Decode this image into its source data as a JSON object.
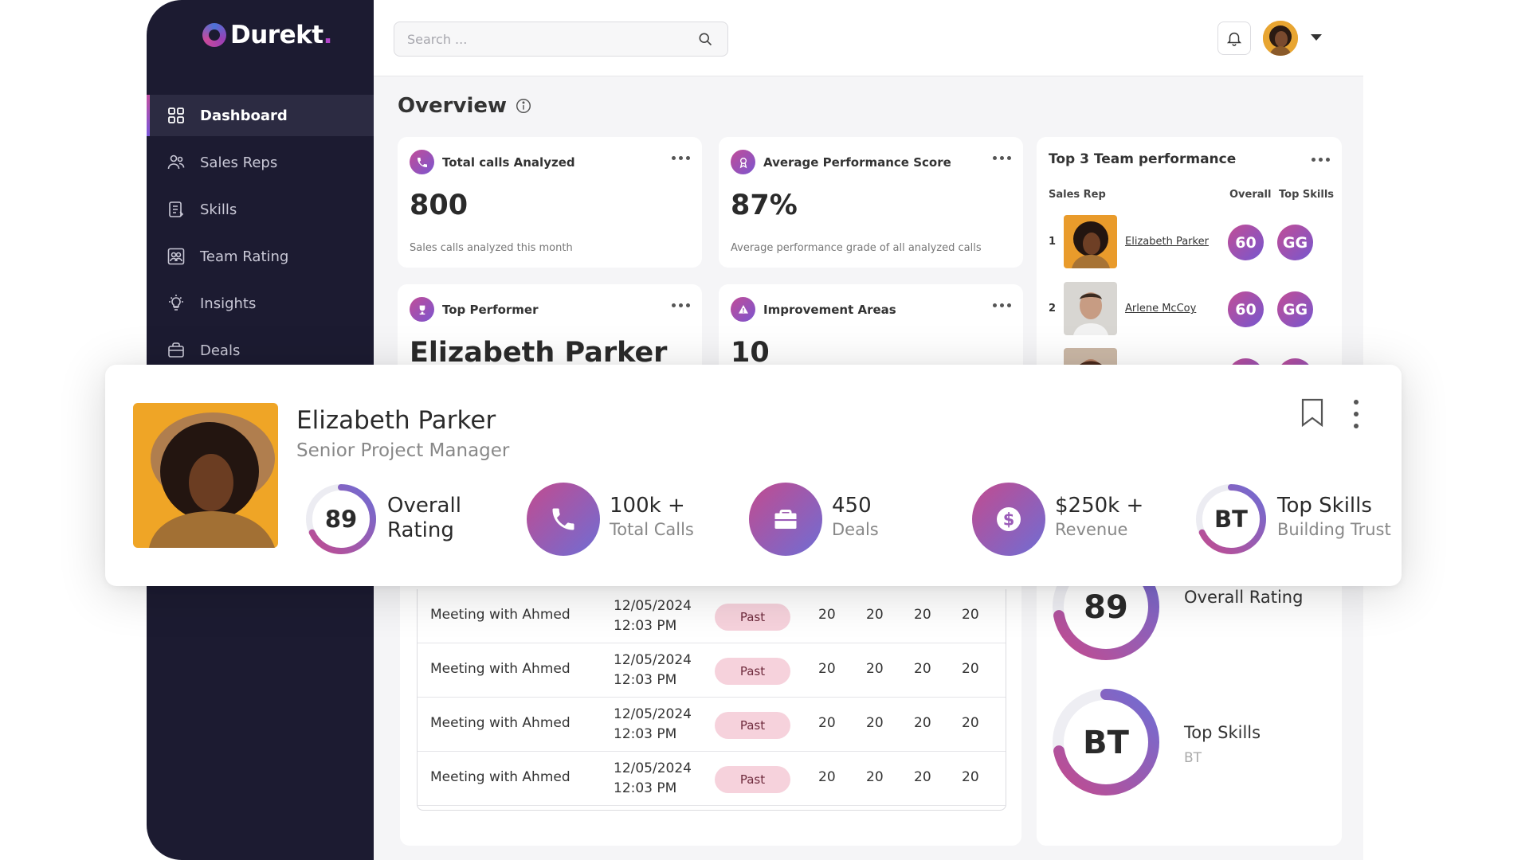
{
  "app": {
    "logo_text": "Durekt",
    "logo_dot": "."
  },
  "sidebar": {
    "items": [
      {
        "label": "Dashboard",
        "icon": "dashboard-icon",
        "active": true
      },
      {
        "label": "Sales Reps",
        "icon": "users-icon"
      },
      {
        "label": "Skills",
        "icon": "skills-icon"
      },
      {
        "label": "Team Rating",
        "icon": "team-rating-icon"
      },
      {
        "label": "Insights",
        "icon": "lightbulb-icon"
      },
      {
        "label": "Deals",
        "icon": "briefcase-icon"
      }
    ]
  },
  "header": {
    "search_placeholder": "Search ..."
  },
  "overview": {
    "title": "Overview",
    "cards": [
      {
        "title": "Total calls Analyzed",
        "value": "800",
        "sub": "Sales calls analyzed this month",
        "icon": "phone-icon"
      },
      {
        "title": "Average Performance Score",
        "value": "87%",
        "sub": "Average performance grade of all analyzed calls",
        "icon": "award-icon"
      },
      {
        "title": "Top Performer",
        "value": "Elizabeth Parker",
        "icon": "trophy-icon"
      },
      {
        "title": "Improvement Areas",
        "value": "10",
        "icon": "alert-icon"
      }
    ]
  },
  "team": {
    "title": "Top 3 Team performance",
    "col_rep": "Sales Rep",
    "col_overall": "Overall",
    "col_skills": "Top Skills",
    "rows": [
      {
        "rank": "1",
        "name": "Elizabeth Parker",
        "overall": "60",
        "skills": "GG"
      },
      {
        "rank": "2",
        "name": "Arlene McCoy",
        "overall": "60",
        "skills": "GG"
      }
    ]
  },
  "meetings": {
    "rows": [
      {
        "name": "Meeting with Ahmed",
        "date": "12/05/2024",
        "time": "12:03 PM",
        "status": "Past",
        "a": "20",
        "b": "20",
        "c": "20",
        "d": "20"
      },
      {
        "name": "Meeting with Ahmed",
        "date": "12/05/2024",
        "time": "12:03 PM",
        "status": "Past",
        "a": "20",
        "b": "20",
        "c": "20",
        "d": "20"
      },
      {
        "name": "Meeting with Ahmed",
        "date": "12/05/2024",
        "time": "12:03 PM",
        "status": "Past",
        "a": "20",
        "b": "20",
        "c": "20",
        "d": "20"
      },
      {
        "name": "Meeting with Ahmed",
        "date": "12/05/2024",
        "time": "12:03 PM",
        "status": "Past",
        "a": "20",
        "b": "20",
        "c": "20",
        "d": "20"
      }
    ]
  },
  "rep_summary": {
    "overall_value": "89",
    "overall_label": "Overall Rating",
    "overall_fraction": 0.72,
    "skills_value": "BT",
    "skills_label": "Top Skills",
    "skills_sub": "BT",
    "skills_fraction": 0.72
  },
  "profile": {
    "name": "Elizabeth Parker",
    "role": "Senior Project Manager",
    "rating_value": "89",
    "rating_fraction": 0.68,
    "rating_line1": "Overall",
    "rating_line2": "Rating",
    "calls_line1": "100k +",
    "calls_line2": "Total Calls",
    "deals_line1": "450",
    "deals_line2": "Deals",
    "revenue_line1": "$250k +",
    "revenue_line2": "Revenue",
    "skills_badge": "BT",
    "skills_fraction": 0.68,
    "skills_line1": "Top Skills",
    "skills_line2": "Building Trust"
  },
  "colors": {
    "sidebar": "#1c1b31",
    "accent_start": "#c24b8f",
    "accent_end": "#6f6dd4",
    "pill_bg": "#f6d2dc"
  }
}
